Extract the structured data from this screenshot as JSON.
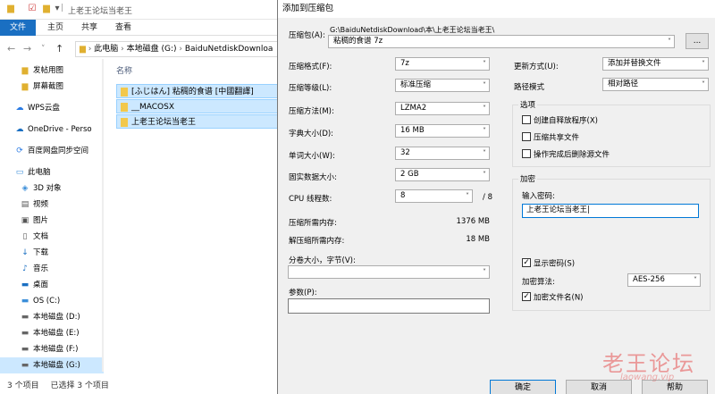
{
  "explorer": {
    "window_title": "上老王论坛当老王",
    "ribbon_tabs": [
      "文件",
      "主页",
      "共享",
      "查看"
    ],
    "breadcrumbs": [
      "此电脑",
      "本地磁盘 (G:)",
      "BaiduNetdiskDownloa"
    ],
    "sidebar_items": [
      {
        "label": "发帖用图",
        "icon": "folder-icon"
      },
      {
        "label": "屏幕截图",
        "icon": "folder-icon"
      },
      {
        "label": "WPS云盘",
        "icon": "cloud-icon"
      },
      {
        "label": "OneDrive - Perso",
        "icon": "cloud-icon"
      },
      {
        "label": "百度网盘同步空间",
        "icon": "sync-icon"
      },
      {
        "label": "此电脑",
        "icon": "computer-icon"
      },
      {
        "label": "3D 对象",
        "icon": "cube-icon"
      },
      {
        "label": "视频",
        "icon": "video-icon"
      },
      {
        "label": "图片",
        "icon": "picture-icon"
      },
      {
        "label": "文档",
        "icon": "document-icon"
      },
      {
        "label": "下载",
        "icon": "download-icon"
      },
      {
        "label": "音乐",
        "icon": "music-icon"
      },
      {
        "label": "桌面",
        "icon": "desktop-icon"
      },
      {
        "label": "OS (C:)",
        "icon": "drive-icon"
      },
      {
        "label": "本地磁盘 (D:)",
        "icon": "drive-icon"
      },
      {
        "label": "本地磁盘 (E:)",
        "icon": "drive-icon"
      },
      {
        "label": "本地磁盘 (F:)",
        "icon": "drive-icon"
      },
      {
        "label": "本地磁盘 (G:)",
        "icon": "drive-icon"
      }
    ],
    "column_header": "名称",
    "files": [
      "[ふじはん] 粘稠的食谱 [中國翻譯]",
      "__MACOSX",
      "上老王论坛当老王"
    ],
    "status_count": "3 个项目",
    "status_selected": "已选择 3 个项目"
  },
  "dialog": {
    "title": "添加到压缩包",
    "archive_label": "压缩包(A):",
    "archive_path": "G:\\BaiduNetdiskDownload\\本\\上老王论坛当老王\\",
    "archive_name": "粘稠的食谱 7z",
    "browse_label": "...",
    "format_label": "压缩格式(F):",
    "format_value": "7z",
    "level_label": "压缩等级(L):",
    "level_value": "标准压缩",
    "method_label": "压缩方法(M):",
    "method_value": "LZMA2",
    "dict_label": "字典大小(D):",
    "dict_value": "16 MB",
    "word_label": "单词大小(W):",
    "word_value": "32",
    "solid_label": "固实数据大小:",
    "solid_value": "2 GB",
    "cpu_label": "CPU 线程数:",
    "cpu_value": "8",
    "cpu_total": "/ 8",
    "mem_comp_label": "压缩所需内存:",
    "mem_comp_value": "1376 MB",
    "mem_decomp_label": "解压缩所需内存:",
    "mem_decomp_value": "18 MB",
    "split_label": "分卷大小，字节(V):",
    "split_value": "",
    "params_label": "参数(P):",
    "params_value": "",
    "update_label": "更新方式(U):",
    "update_value": "添加并替换文件",
    "path_mode_label": "路径模式",
    "path_mode_value": "相对路径",
    "options_title": "选项",
    "opt_sfx": "创建自释放程序(X)",
    "opt_shared": "压缩共享文件",
    "opt_delete": "操作完成后删除源文件",
    "encryption_title": "加密",
    "password_label": "输入密码:",
    "password_value": "上老王论坛当老王",
    "show_password": "显示密码(S)",
    "enc_method_label": "加密算法:",
    "enc_method_value": "AES-256",
    "encrypt_names": "加密文件名(N)",
    "ok_label": "确定",
    "cancel_label": "取消",
    "help_label": "帮助"
  },
  "watermark": {
    "main": "老王论坛",
    "sub": "laowang.vip"
  }
}
